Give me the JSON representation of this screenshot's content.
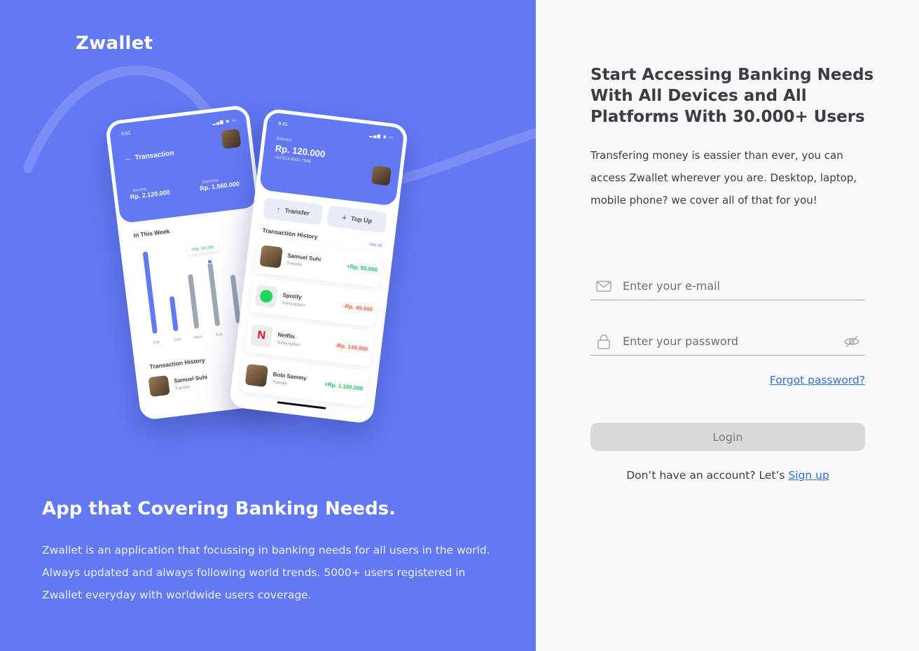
{
  "brand": {
    "name": "Zwallet"
  },
  "colors": {
    "primary": "#6379F4",
    "link": "#2F6FD6",
    "income": "#1EC15F",
    "expense": "#FF5B37"
  },
  "hero": {
    "headline": "App that Covering Banking Needs.",
    "description": "Zwallet is an application that focussing in banking needs for all users in the world. Always updated and always following world trends. 5000+ users registered in Zwallet everyday with worldwide users coverage."
  },
  "mock_back": {
    "time": "9:41",
    "title": "Transaction",
    "income_label": "Income",
    "income_value": "Rp. 2.120.000",
    "expense_label": "Expense",
    "expense_value": "Rp. 1.560.000",
    "week_title": "In This Week",
    "tooltip": "+Rp. 65.000",
    "days": [
      "Sat",
      "Sun",
      "Mon",
      "Tue"
    ],
    "history_title": "Transaction History",
    "history_item": {
      "name": "Samuel Suhi",
      "sub": "Transfer"
    }
  },
  "mock_front": {
    "time": "9:41",
    "balance_label": "Balance",
    "balance_value": "Rp. 120.000",
    "phone": "+62 813-9387-7946",
    "transfer_label": "Transfer",
    "topup_label": "Top Up",
    "history_title": "Transaction History",
    "see_all": "See all",
    "items": [
      {
        "name": "Samuel Suhi",
        "sub": "Transfer",
        "amount": "+Rp. 50.000",
        "kind": "plus",
        "icon": "avatar"
      },
      {
        "name": "Spotify",
        "sub": "Subscription",
        "amount": "-Rp. 49.000",
        "kind": "minus",
        "icon": "spotify-logo"
      },
      {
        "name": "Netflix",
        "sub": "Subscription",
        "amount": "-Rp. 149.000",
        "kind": "minus",
        "icon": "netflix-logo"
      },
      {
        "name": "Bobi Sammy",
        "sub": "Transfer",
        "amount": "+Rp. 1.150.000",
        "kind": "plus",
        "icon": "avatar"
      }
    ]
  },
  "auth": {
    "title": "Start Accessing Banking Needs With All Devices and All Platforms With 30.000+ Users",
    "description": "Transfering money is eassier than ever, you can access Zwallet wherever you are. Desktop, laptop, mobile phone? we cover all of that for you!",
    "email_placeholder": "Enter your e-mail",
    "email_icon": "mail-icon",
    "password_placeholder": "Enter your password",
    "password_icon": "lock-icon",
    "toggle_icon": "eye-off-icon",
    "forgot_label": "Forgot password?",
    "login_label": "Login",
    "signup_prompt": "Don’t have an account? Let’s ",
    "signup_label": "Sign up"
  }
}
